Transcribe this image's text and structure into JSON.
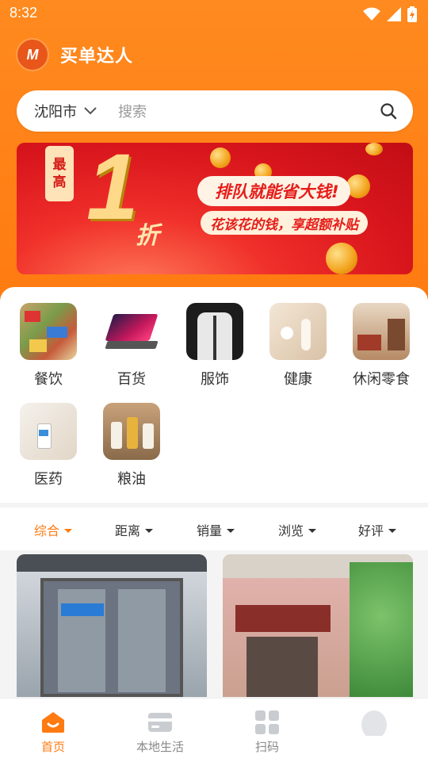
{
  "status_bar": {
    "time": "8:32"
  },
  "app": {
    "logo_text": "M",
    "name": "买单达人"
  },
  "search": {
    "city": "沈阳市",
    "placeholder": "搜索"
  },
  "banner": {
    "badge_line1": "最",
    "badge_line2": "高",
    "big_number": "1",
    "unit": "折",
    "slogan": "排队就能省大钱!",
    "subtitle": "花该花的钱，享超额补贴"
  },
  "categories": [
    {
      "label": "餐饮",
      "icon": "food-image"
    },
    {
      "label": "百货",
      "icon": "laptop-image"
    },
    {
      "label": "服饰",
      "icon": "jacket-image"
    },
    {
      "label": "健康",
      "icon": "jewelry-image"
    },
    {
      "label": "休闲零食",
      "icon": "snack-shop-image"
    },
    {
      "label": "医药",
      "icon": "medicine-image"
    },
    {
      "label": "粮油",
      "icon": "oil-bottles-image"
    }
  ],
  "filters": [
    {
      "label": "综合",
      "active": true
    },
    {
      "label": "距离",
      "active": false
    },
    {
      "label": "销量",
      "active": false
    },
    {
      "label": "浏览",
      "active": false
    },
    {
      "label": "好评",
      "active": false
    }
  ],
  "shops": [
    {
      "image": "glass-door-storefront"
    },
    {
      "image": "pink-building-storefront"
    }
  ],
  "tabbar": [
    {
      "label": "首页",
      "icon": "home-icon",
      "active": true
    },
    {
      "label": "本地生活",
      "icon": "card-icon",
      "active": false
    },
    {
      "label": "扫码",
      "icon": "grid-icon",
      "active": false
    },
    {
      "label": "",
      "icon": "profile-icon",
      "active": false
    }
  ],
  "colors": {
    "accent": "#ff7a10",
    "banner_red": "#e51d19"
  }
}
